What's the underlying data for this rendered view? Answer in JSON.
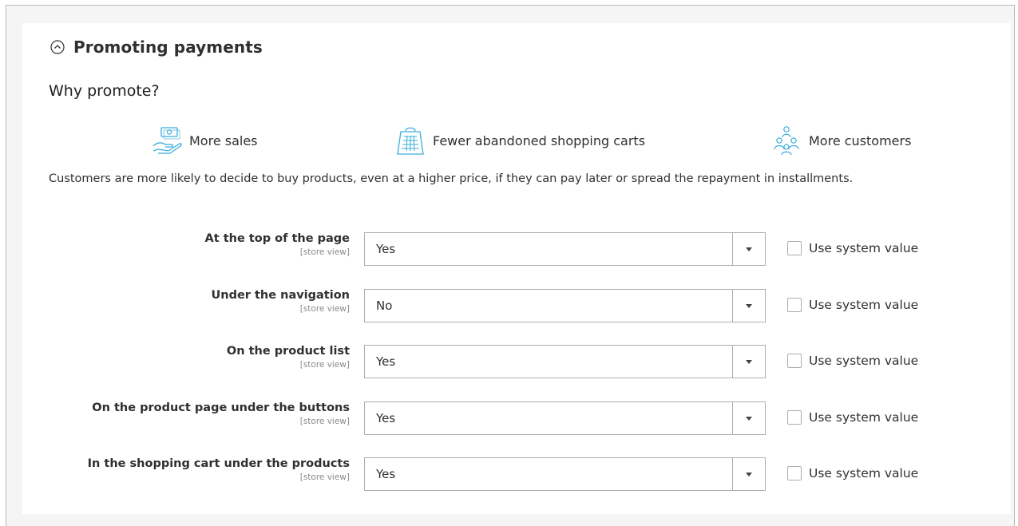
{
  "section": {
    "title": "Promoting payments",
    "collapse_icon": "chevron-up-circle-icon"
  },
  "why": {
    "heading": "Why promote?",
    "benefits": [
      {
        "icon": "hand-money-icon",
        "label": "More sales"
      },
      {
        "icon": "shopping-bag-icon",
        "label": "Fewer abandoned shopping carts"
      },
      {
        "icon": "customers-group-icon",
        "label": "More customers"
      }
    ],
    "description": "Customers are more likely to decide to buy products, even at a higher price, if they can pay later or spread the repayment in installments."
  },
  "settings": [
    {
      "label": "At the top of the page",
      "scope": "[store view]",
      "value": "Yes",
      "checkbox_label": "Use system value",
      "checked": false
    },
    {
      "label": "Under the navigation",
      "scope": "[store view]",
      "value": "No",
      "checkbox_label": "Use system value",
      "checked": false
    },
    {
      "label": "On the product list",
      "scope": "[store view]",
      "value": "Yes",
      "checkbox_label": "Use system value",
      "checked": false
    },
    {
      "label": "On the product page under the buttons",
      "scope": "[store view]",
      "value": "Yes",
      "checkbox_label": "Use system value",
      "checked": false
    },
    {
      "label": "In the shopping cart under the products",
      "scope": "[store view]",
      "value": "Yes",
      "checkbox_label": "Use system value",
      "checked": false
    }
  ],
  "colors": {
    "icon_accent": "#3aaedb",
    "panel_bg": "#ffffff",
    "frame_bg": "#f5f5f5",
    "border": "#adadad"
  }
}
